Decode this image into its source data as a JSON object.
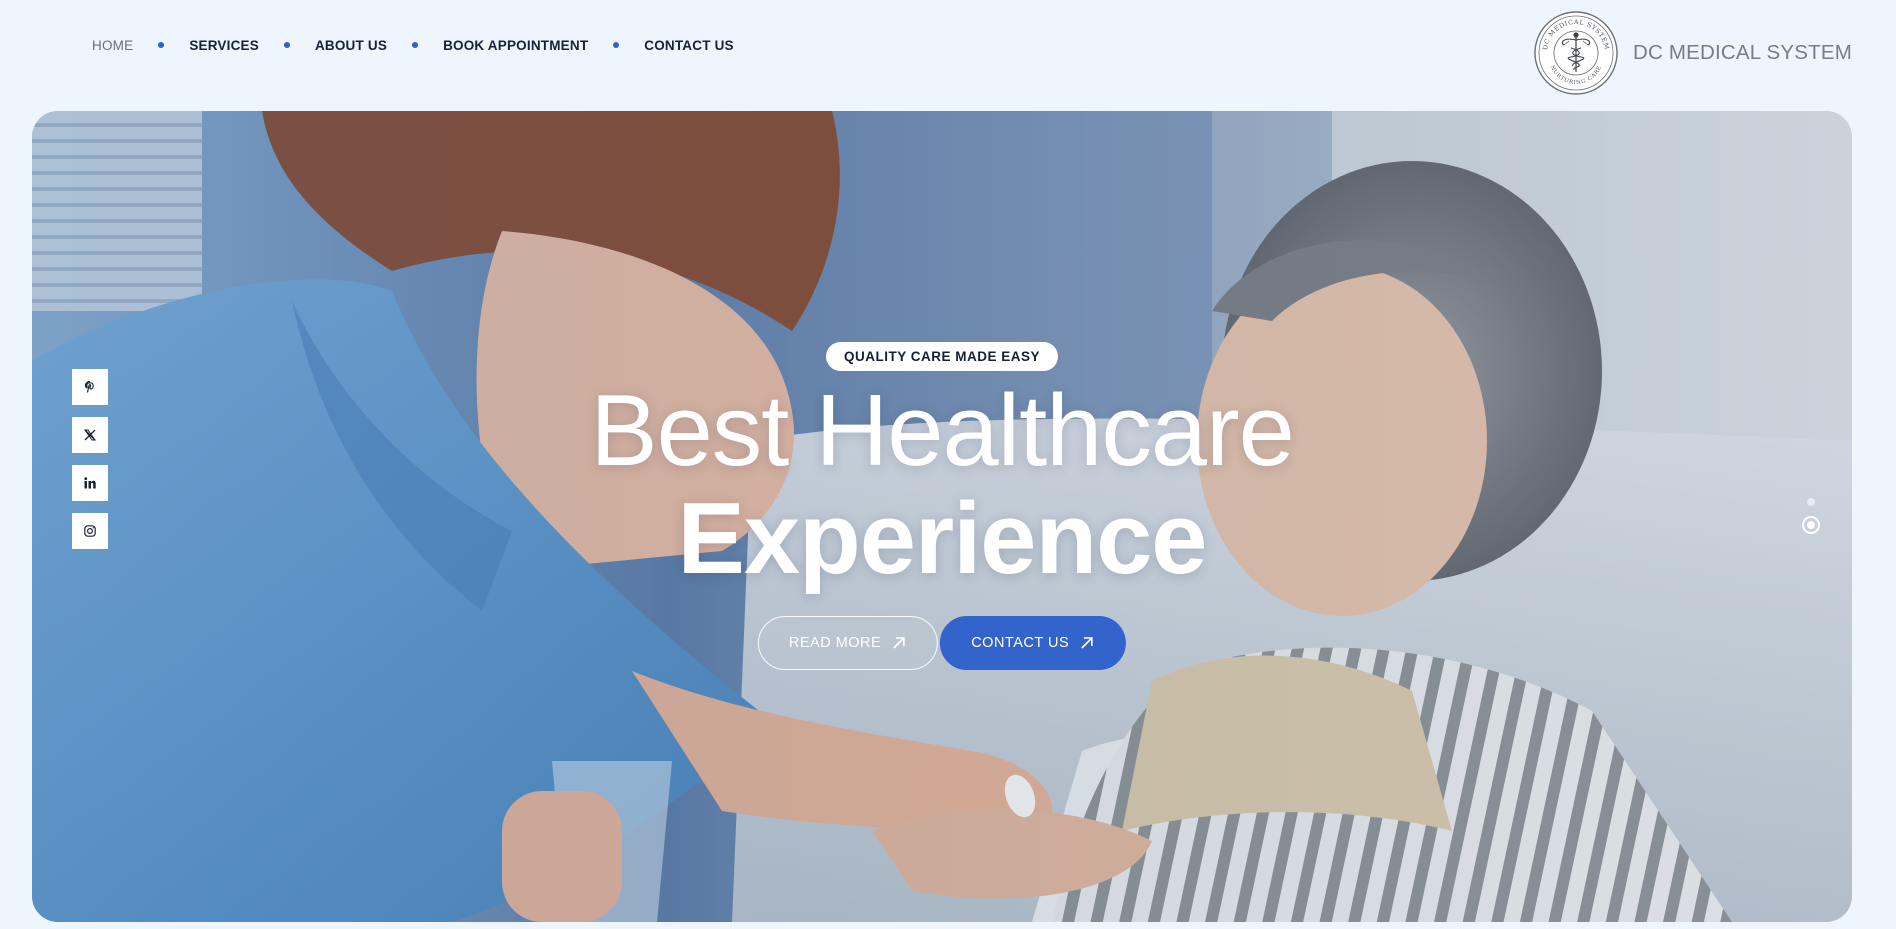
{
  "nav": {
    "items": [
      {
        "label": "HOME",
        "active": true
      },
      {
        "label": "SERVICES"
      },
      {
        "label": "ABOUT US"
      },
      {
        "label": "BOOK APPOINTMENT"
      },
      {
        "label": "CONTACT US"
      }
    ]
  },
  "brand": {
    "name": "DC MEDICAL SYSTEM",
    "seal_text_top": "DC MEDICAL SYSTEM",
    "seal_text_bottom": "NURTURING CARE",
    "seal_icon": "caduceus-icon"
  },
  "hero": {
    "eyebrow": "QUALITY CARE MADE EASY",
    "headline_line1": "Best Healthcare",
    "headline_line2": "Experience",
    "read_more": "READ MORE",
    "contact_us": "CONTACT US",
    "button_icon": "arrow-up-right-icon",
    "image": "nurse-caring-for-elderly-patient-photo"
  },
  "social": [
    "pinterest-icon",
    "x-twitter-icon",
    "linkedin-icon",
    "instagram-icon"
  ],
  "slider": {
    "slides": 2,
    "active": 2
  },
  "colors": {
    "accent": "#3264cc",
    "nav_text": "#16213b",
    "page_bg": "#eef5fc",
    "brand_text": "#7a7c80"
  }
}
